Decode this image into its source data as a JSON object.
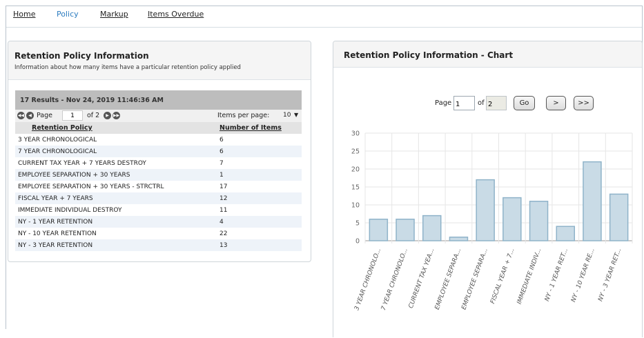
{
  "nav": {
    "items": [
      {
        "label": "Home",
        "active": false
      },
      {
        "label": "Policy",
        "active": true
      },
      {
        "label": "Markup",
        "active": false
      },
      {
        "label": "Items Overdue",
        "active": false
      }
    ]
  },
  "left_panel": {
    "title": "Retention Policy Information",
    "subtitle": "Information about how many items have a particular retention policy applied",
    "results_summary": "17 Results - Nov 24, 2019 11:46:36 AM",
    "pager": {
      "page_label": "Page",
      "page_value": "1",
      "of_label": "of 2",
      "items_per_page_label": "Items per page:",
      "items_per_page_value": "10"
    },
    "columns": [
      "Retention Policy",
      "Number of Items"
    ],
    "rows": [
      [
        "3 YEAR CHRONOLOGICAL",
        "6"
      ],
      [
        "7 YEAR CHRONOLOGICAL",
        "6"
      ],
      [
        "CURRENT TAX YEAR + 7 YEARS DESTROY",
        "7"
      ],
      [
        "EMPLOYEE SEPARATION + 30 YEARS",
        "1"
      ],
      [
        "EMPLOYEE SEPARATION + 30 YEARS - STRCTRL",
        "17"
      ],
      [
        "FISCAL YEAR + 7 YEARS",
        "12"
      ],
      [
        "IMMEDIATE INDIVIDUAL DESTROY",
        "11"
      ],
      [
        "NY - 1 YEAR RETENTION",
        "4"
      ],
      [
        "NY - 10 YEAR RETENTION",
        "22"
      ],
      [
        "NY - 3 YEAR RETENTION",
        "13"
      ]
    ]
  },
  "right_panel": {
    "title": "Retention Policy Information - Chart",
    "pager": {
      "page_label": "Page",
      "page_value": "1",
      "of_label": "of",
      "total_pages": "2",
      "go_label": "Go",
      "next_label": ">",
      "last_label": ">>"
    }
  },
  "chart_data": {
    "type": "bar",
    "categories": [
      "3 YEAR CHRONOLO...",
      "7 YEAR CHRONOLO...",
      "CURRENT TAX YEA...",
      "EMPLOYEE SEPARA...",
      "EMPLOYEE SEPARA...",
      "FISCAL YEAR + 7...",
      "IMMEDIATE INDIV...",
      "NY - 1 YEAR RET...",
      "NY - 10 YEAR RE...",
      "NY - 3 YEAR RET..."
    ],
    "values": [
      6,
      6,
      7,
      1,
      17,
      12,
      11,
      4,
      22,
      13
    ],
    "yticks": [
      0,
      5,
      10,
      15,
      20,
      25,
      30
    ],
    "ylim": [
      0,
      30
    ],
    "grid": true,
    "colors": {
      "bar_fill": "#c9dbe6",
      "bar_stroke": "#8fb3c9",
      "grid": "#e6e6e6",
      "axis": "#999999"
    }
  }
}
